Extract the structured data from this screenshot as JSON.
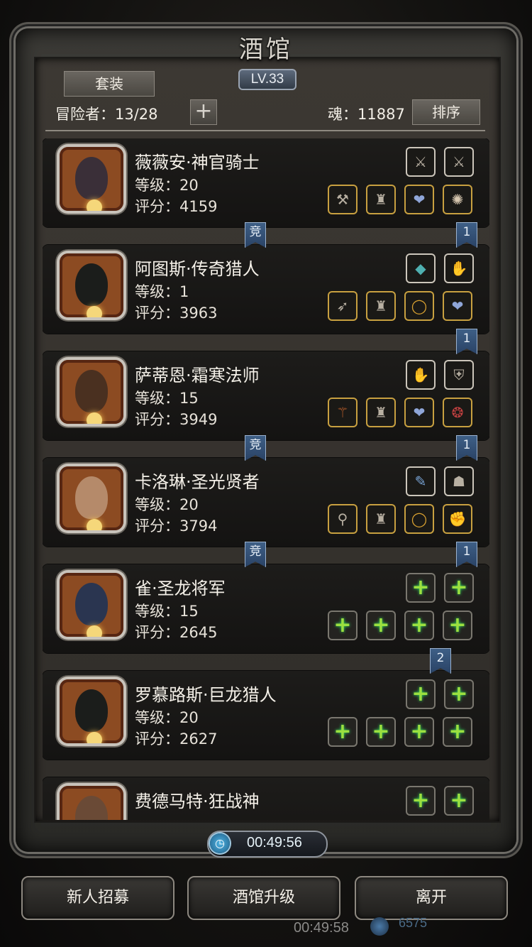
{
  "header": {
    "title": "酒馆",
    "level": "LV.33",
    "suit_button": "套装",
    "adventurers": "冒险者：13/28",
    "add_icon": "+",
    "soul": "魂：11887",
    "sort_button": "排序"
  },
  "heroes": [
    {
      "name": "薇薇安·神官骑士",
      "level": "等级：20",
      "score": "评分：4159",
      "face_color": "#3a2f38",
      "top_slots": [
        "weapon-icon",
        "weapon-icon"
      ],
      "bottom_slots": [
        "hammer-icon",
        "armor-icon",
        "heart-gem-icon",
        "medal-icon"
      ]
    },
    {
      "name": "阿图斯·传奇猎人",
      "level": "等级：1",
      "score": "评分：3963",
      "face_color": "#1b1d1b",
      "top_slots": [
        "stone-icon",
        "glove-icon"
      ],
      "bottom_slots": [
        "rifle-icon",
        "armor-icon",
        "ring-icon",
        "heart-gem-icon"
      ]
    },
    {
      "name": "萨蒂恩·霜寒法师",
      "level": "等级：15",
      "score": "评分：3949",
      "face_color": "#4a3020",
      "top_slots": [
        "glove-icon",
        "shield-icon"
      ],
      "bottom_slots": [
        "staff-icon",
        "armor-icon",
        "heart-gem-icon",
        "amulet-icon"
      ]
    },
    {
      "name": "卡洛琳·圣光贤者",
      "level": "等级：20",
      "score": "评分：3794",
      "face_color": "#b58a6a",
      "top_slots": [
        "scroll-icon",
        "mask-icon"
      ],
      "bottom_slots": [
        "mace-icon",
        "armor-icon",
        "ring-icon",
        "gauntlet-icon"
      ]
    },
    {
      "name": "雀·圣龙将军",
      "level": "等级：15",
      "score": "评分：2645",
      "face_color": "#2a3550",
      "top_slots": [
        "+",
        "+"
      ],
      "bottom_slots": [
        "+",
        "+",
        "+",
        "+"
      ]
    },
    {
      "name": "罗慕路斯·巨龙猎人",
      "level": "等级：20",
      "score": "评分：2627",
      "face_color": "#1b1d1b",
      "top_slots": [
        "+",
        "+"
      ],
      "bottom_slots": [
        "+",
        "+",
        "+",
        "+"
      ]
    },
    {
      "name": "费德马特·狂战神",
      "level": "",
      "score": "",
      "face_color": "#6a4a36",
      "top_slots": [
        "+",
        "+"
      ],
      "bottom_slots": []
    }
  ],
  "ribbons": [
    {
      "text": "竞",
      "after": 0,
      "side": "left"
    },
    {
      "text": "1",
      "after": 0,
      "side": "right"
    },
    {
      "text": "1",
      "after": 1,
      "side": "right"
    },
    {
      "text": "竞",
      "after": 2,
      "side": "left"
    },
    {
      "text": "1",
      "after": 2,
      "side": "right"
    },
    {
      "text": "竞",
      "after": 3,
      "side": "left"
    },
    {
      "text": "1",
      "after": 3,
      "side": "right"
    },
    {
      "text": "2",
      "after": 4,
      "side": "mid"
    }
  ],
  "timer": "00:49:56",
  "footer": {
    "recruit": "新人招募",
    "upgrade": "酒馆升级",
    "leave": "离开",
    "background_timer": "00:49:58",
    "background_number": "6575"
  },
  "colors": {
    "frame": "#3b3a36",
    "card": "#1d1c1a",
    "plus_green": "#9be040",
    "ribbon_blue": "#2a4366"
  }
}
